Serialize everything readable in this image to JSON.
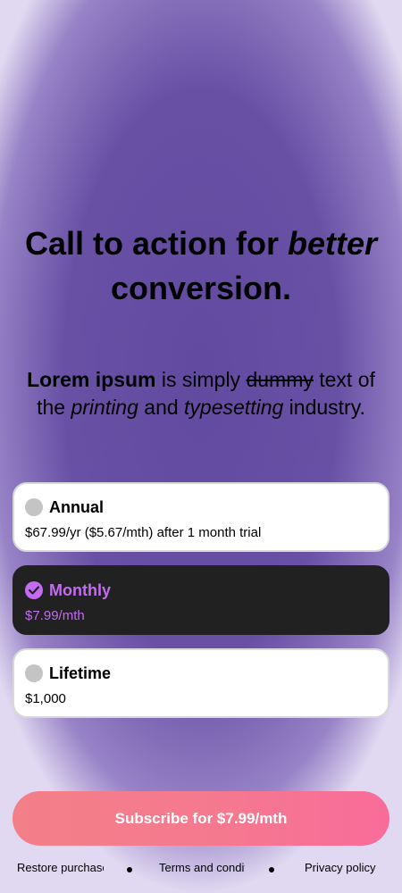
{
  "headline": {
    "part1": "Call to action for ",
    "emphasis": "better",
    "part2": "conversion."
  },
  "subtext": {
    "bold": "Lorem ipsum",
    "t1": " is simply ",
    "strike": "dummy",
    "t2": " text of the ",
    "italic1": "printing",
    "t3": " and ",
    "italic2": "typesetting",
    "t4": " industry."
  },
  "plans": [
    {
      "title": "Annual",
      "price": "$67.99/yr ($5.67/mth) after 1 month trial",
      "selected": false
    },
    {
      "title": "Monthly",
      "price": "$7.99/mth",
      "selected": true
    },
    {
      "title": "Lifetime",
      "price": "$1,000",
      "selected": false
    }
  ],
  "subscribe_label": "Subscribe for $7.99/mth",
  "footer": {
    "restore": "Restore purchases",
    "terms": "Terms and conditions",
    "privacy": "Privacy policy"
  },
  "colors": {
    "background": "#6a51a5",
    "accent": "#c36cf2",
    "selected_card": "#212121",
    "button_gradient_start": "#f37f88",
    "button_gradient_end": "#f86c9a"
  }
}
